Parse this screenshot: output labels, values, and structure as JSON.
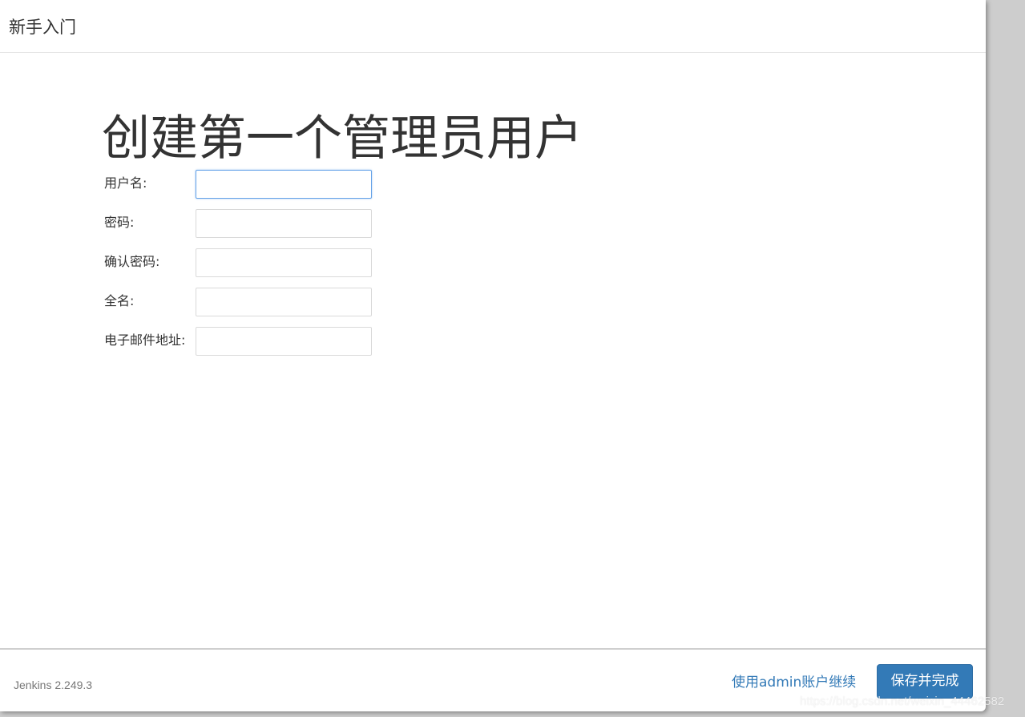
{
  "header": {
    "title": "新手入门"
  },
  "main": {
    "page_title": "创建第一个管理员用户",
    "fields": [
      {
        "label": "用户名:",
        "value": ""
      },
      {
        "label": "密码:",
        "value": ""
      },
      {
        "label": "确认密码:",
        "value": ""
      },
      {
        "label": "全名:",
        "value": ""
      },
      {
        "label": "电子邮件地址:",
        "value": ""
      }
    ]
  },
  "footer": {
    "version": "Jenkins 2.249.3",
    "continue_as_admin_label": "使用admin账户继续",
    "save_label": "保存并完成"
  },
  "watermark": "https://blog.csdn.net/weixin_44462582",
  "colors": {
    "accent": "#337ab7",
    "focus_border": "#66a3e8",
    "text": "#333333",
    "muted": "#777777"
  }
}
